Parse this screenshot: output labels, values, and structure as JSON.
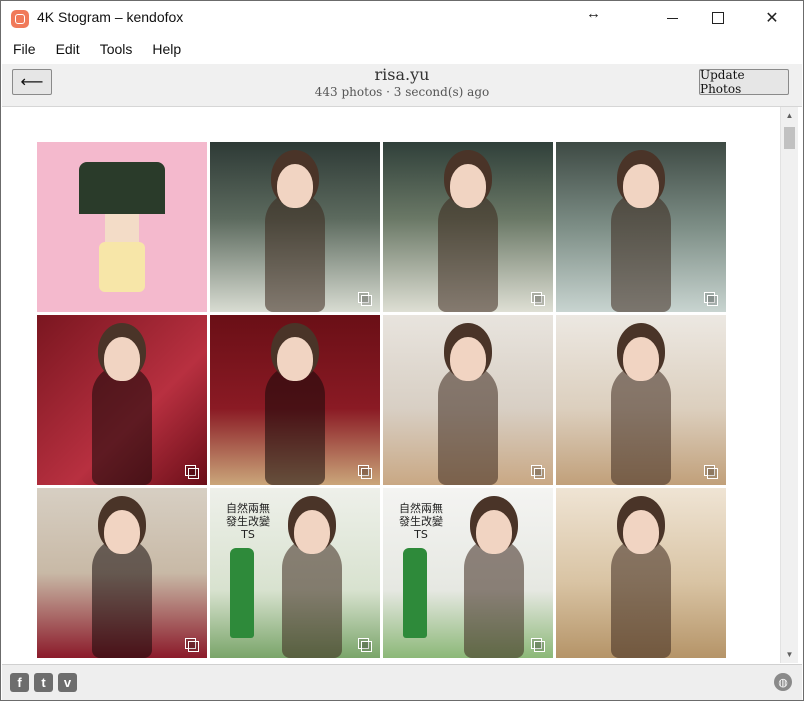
{
  "window": {
    "title": "4K Stogram – kendofox",
    "move_glyph": "↔",
    "close_glyph": "✕"
  },
  "menu": {
    "items": [
      {
        "label": "File"
      },
      {
        "label": "Edit"
      },
      {
        "label": "Tools"
      },
      {
        "label": "Help"
      }
    ]
  },
  "header": {
    "back_glyph": "⟵",
    "account_name": "risa.yu",
    "meta": "443 photos · 3 second(s) ago",
    "update_label": "Update Photos"
  },
  "photos": {
    "items": [
      {
        "kind": "pixel-art",
        "gallery": false
      },
      {
        "kind": "portrait",
        "gallery": true
      },
      {
        "kind": "portrait",
        "gallery": true
      },
      {
        "kind": "portrait",
        "gallery": true
      },
      {
        "kind": "portrait",
        "gallery": true
      },
      {
        "kind": "portrait",
        "gallery": true
      },
      {
        "kind": "portrait",
        "gallery": true
      },
      {
        "kind": "portrait",
        "gallery": true
      },
      {
        "kind": "portrait",
        "gallery": true
      },
      {
        "kind": "ad",
        "gallery": true,
        "caption": "自然兩無\n發生改變 TS"
      },
      {
        "kind": "ad",
        "gallery": true,
        "caption": "自然兩無\n發生改變 TS"
      },
      {
        "kind": "portrait",
        "gallery": false
      }
    ]
  },
  "footer": {
    "social": [
      {
        "name": "facebook",
        "glyph": "f"
      },
      {
        "name": "twitter",
        "glyph": "t"
      },
      {
        "name": "vimeo",
        "glyph": "v"
      }
    ],
    "globe_glyph": "◍"
  },
  "colors": {
    "accent": "#f07a5a",
    "chrome": "#f0f0f0",
    "footer_bg": "#eeeeee"
  }
}
